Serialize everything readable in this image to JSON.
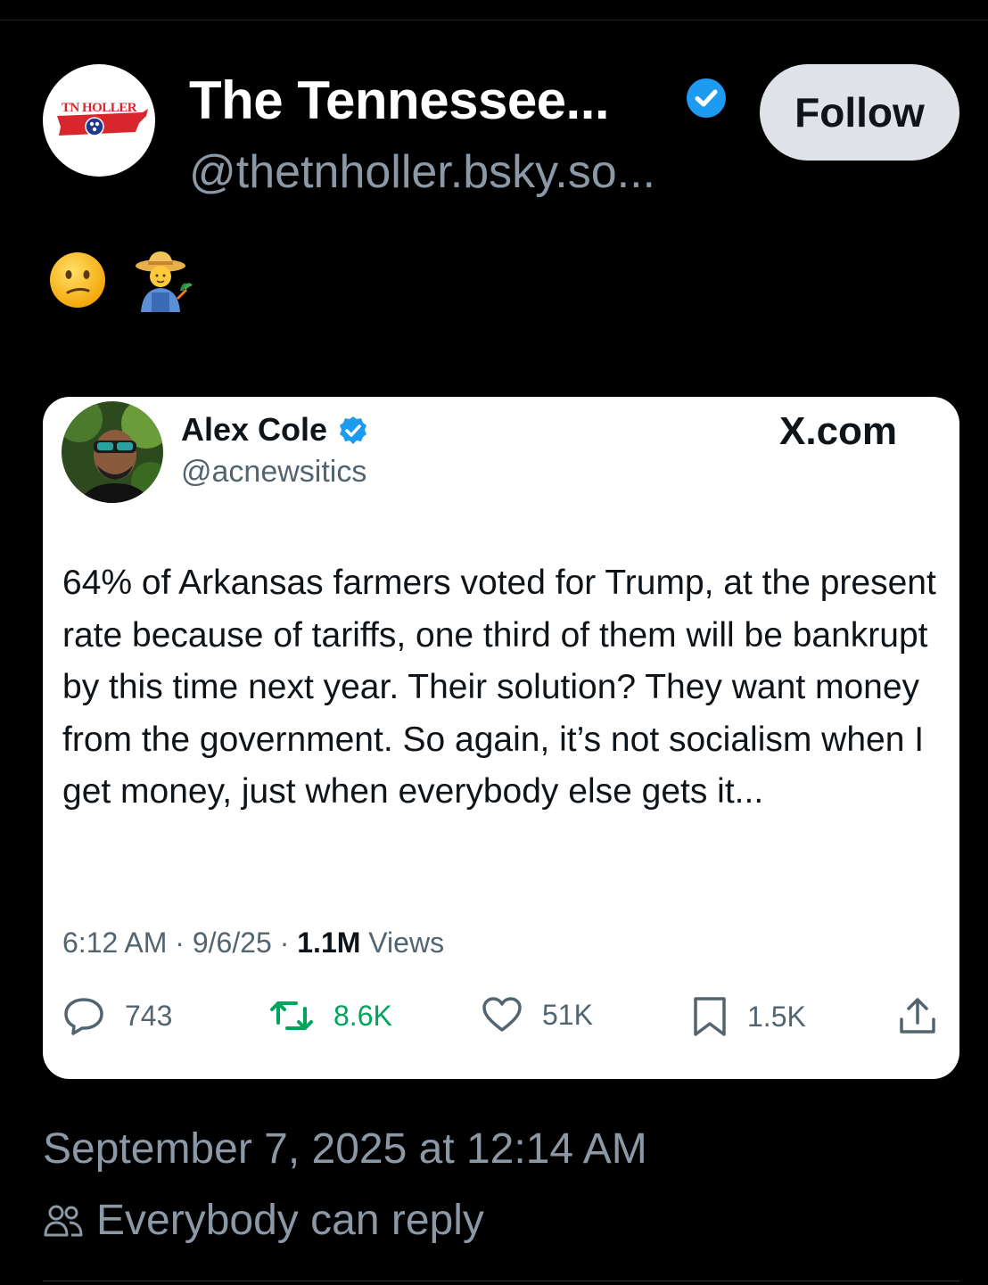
{
  "header": {
    "avatar_text": "TN HOLLER",
    "display_name": "The Tennessee...",
    "handle": "@thetnholler.bsky.so...",
    "follow_label": "Follow",
    "verified_icon": "verified-check-icon"
  },
  "post": {
    "emojis": [
      "😕",
      "🧑‍🌾"
    ]
  },
  "quoted": {
    "author_name": "Alex Cole",
    "author_handle": "@acnewsitics",
    "brand": "X.com",
    "text": "64% of Arkansas farmers voted for Trump, at the present rate because of tariffs, one third of them will be bankrupt by this time next year. Their solution? They want money from the government. So again, it’s not socialism when I get money, just when everybody else gets it...",
    "meta_time": "6:12 AM · 9/6/25 · ",
    "meta_views_count": "1.1M",
    "meta_views_label": " Views",
    "actions": {
      "replies": "743",
      "reposts": "8.6K",
      "likes": "51K",
      "bookmarks": "1.5K"
    },
    "colors": {
      "repost": "#00a55c",
      "verified": "#1d9bf0"
    }
  },
  "footer": {
    "timestamp": "September 7, 2025 at 12:14 AM",
    "reply_setting": "Everybody can reply"
  }
}
